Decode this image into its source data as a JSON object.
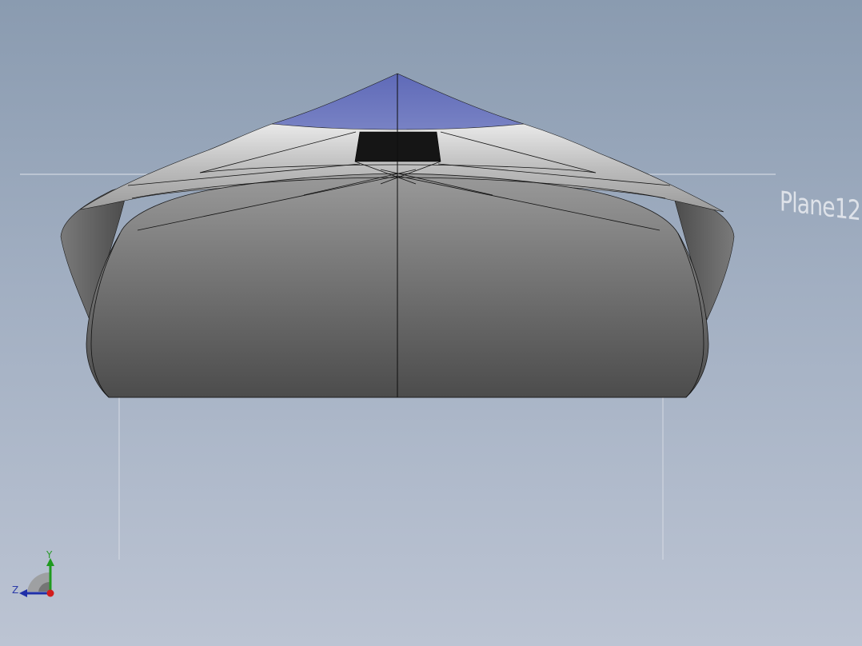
{
  "viewport": {
    "background_top": "#8a9bb0",
    "background_bottom": "#bcc4d3"
  },
  "plane": {
    "label": "Plane12"
  },
  "model": {
    "body_color": "#6a6a6a",
    "top_face_color": "#6c77bd",
    "opening_color": "#141414",
    "edge_color": "#111111"
  },
  "triad": {
    "y_label": "Y",
    "z_label": "Z",
    "y_color": "#1f9a1f",
    "z_color": "#1f2fa8",
    "origin_color": "#d21c1c"
  }
}
